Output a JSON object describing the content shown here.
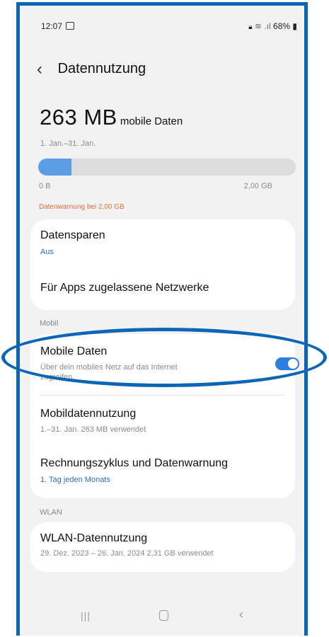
{
  "status_bar": {
    "time": "12:07",
    "battery": "68%"
  },
  "header": {
    "title": "Datennutzung"
  },
  "usage": {
    "amount": "263 MB",
    "label": "mobile Daten",
    "period": "1. Jan.–31. Jan.",
    "bar_min": "0 B",
    "bar_max": "2,00 GB",
    "bar_fill_fraction": 0.13,
    "warning": "Datenwarnung bei 2,00 GB"
  },
  "card1": {
    "saver_title": "Datensparen",
    "saver_value": "Aus",
    "networks_title": "Für Apps zugelassene Netzwerke"
  },
  "section_mobile": "Mobil",
  "card2": {
    "mobile_data_title": "Mobile Daten",
    "mobile_data_sub1": "Über dein mobiles Netz auf das Internet",
    "mobile_data_sub2": "zugreifen.",
    "mobile_data_enabled": true,
    "usage_title": "Mobildatennutzung",
    "usage_sub": "1.–31. Jan. 263 MB verwendet",
    "billing_title": "Rechnungszyklus und Datenwarnung",
    "billing_sub": "1. Tag jeden Monats"
  },
  "section_wlan": "WLAN",
  "card3": {
    "wlan_title": "WLAN-Datennutzung",
    "wlan_sub": "29. Dez. 2023 – 26. Jan. 2024 2,31 GB verwendet"
  },
  "colors": {
    "accent": "#2f7ee0",
    "frame": "#0b66b8",
    "warning": "#e07040"
  }
}
